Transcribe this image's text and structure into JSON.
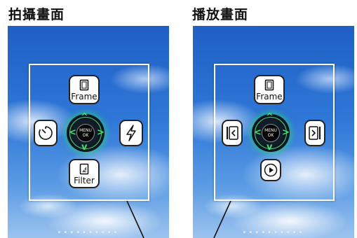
{
  "shooting": {
    "title": "拍攝畫面",
    "frame_button": {
      "label": "Frame",
      "icon": "frame-icon"
    },
    "timer_button": {
      "icon": "self-timer-icon"
    },
    "flash_button": {
      "icon": "flash-icon"
    },
    "filter_button": {
      "label": "Filter",
      "icon": "filter-icon"
    },
    "dpad": {
      "line1": "MENU",
      "line2": "OK"
    },
    "page_dots": "••••••••••"
  },
  "playback": {
    "title": "播放畫面",
    "frame_button": {
      "label": "Frame",
      "icon": "frame-icon"
    },
    "prev_button": {
      "icon": "previous-icon"
    },
    "next_button": {
      "icon": "next-icon"
    },
    "play_button": {
      "icon": "play-icon"
    },
    "dpad": {
      "line1": "MENU",
      "line2": "OK"
    },
    "page_dots": "••••••••••"
  },
  "colors": {
    "sky": "#2f78d8",
    "dpad_glow": "#3fe06a"
  }
}
